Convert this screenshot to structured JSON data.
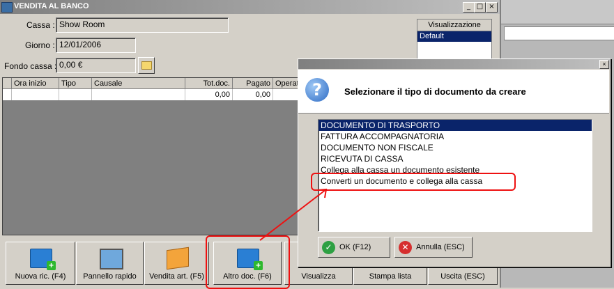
{
  "window": {
    "title": "VENDITA AL BANCO",
    "min": "_",
    "max": "□",
    "close": "×"
  },
  "form": {
    "cassa_label": "Cassa :",
    "cassa_value": "Show Room",
    "giorno_label": "Giorno :",
    "giorno_value": "12/01/2006",
    "fondo_label": "Fondo cassa :",
    "fondo_value": "0,00 €"
  },
  "view_panel": {
    "header": "Visualizzazione",
    "selected": "Default"
  },
  "grid": {
    "columns": [
      "Ora inizio",
      "Tipo",
      "Causale",
      "Tot.doc.",
      "Pagato",
      "Operat"
    ],
    "row": [
      "",
      "",
      "",
      "0,00",
      "0,00",
      ""
    ]
  },
  "bottom_buttons": [
    {
      "label": "Nuova ric. (F4)",
      "icon": "new-receipt-icon"
    },
    {
      "label": "Pannello rapido",
      "icon": "monitor-icon"
    },
    {
      "label": "Vendita art. (F5)",
      "icon": "cards-icon"
    },
    {
      "label": "Altro doc. (F6)",
      "icon": "new-document-icon"
    },
    {
      "label": "Visualizza",
      "icon": ""
    },
    {
      "label": "Stampa lista",
      "icon": ""
    },
    {
      "label": "Uscita (ESC)",
      "icon": ""
    }
  ],
  "dialog": {
    "close": "×",
    "icon": "?",
    "message": "Selezionare il tipo di documento da creare",
    "items": [
      "DOCUMENTO DI TRASPORTO",
      "FATTURA ACCOMPAGNATORIA",
      "DOCUMENTO NON FISCALE",
      "RICEVUTA DI CASSA",
      "Collega alla cassa un documento esistente",
      "Converti un documento e collega alla cassa"
    ],
    "ok_label": "OK (F12)",
    "ok_icon": "✓",
    "cancel_label": "Annulla (ESC)",
    "cancel_icon": "✕"
  },
  "colors": {
    "selection": "#0a246a",
    "highlight": "#e11111",
    "face": "#d4d0c8"
  }
}
